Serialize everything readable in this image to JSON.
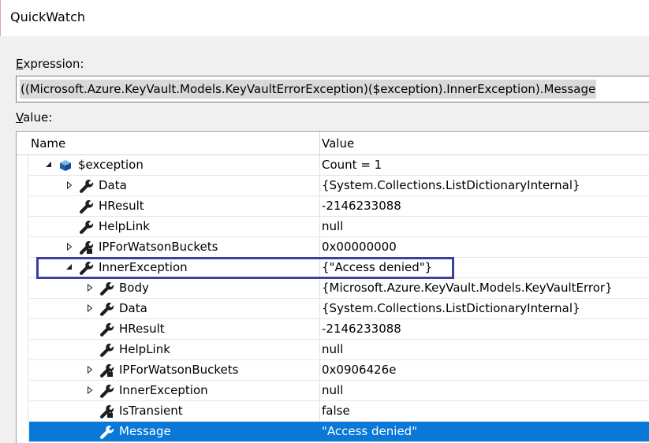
{
  "window": {
    "title": "QuickWatch"
  },
  "expression": {
    "label_underlined": "E",
    "label_rest": "xpression:",
    "value": "((Microsoft.Azure.KeyVault.Models.KeyVaultErrorException)($exception).InnerException).Message"
  },
  "value_label": {
    "label_underlined": "V",
    "label_rest": "alue:"
  },
  "grid": {
    "columns": {
      "name": "Name",
      "value": "Value"
    },
    "rows": [
      {
        "name": "$exception",
        "value": "Count = 1",
        "depth": 0,
        "expander": "expanded",
        "icon": "object-cube-icon"
      },
      {
        "name": "Data",
        "value": "{System.Collections.ListDictionaryInternal}",
        "depth": 1,
        "expander": "collapsed",
        "icon": "wrench-icon"
      },
      {
        "name": "HResult",
        "value": "-2146233088",
        "depth": 1,
        "expander": "none",
        "icon": "wrench-icon"
      },
      {
        "name": "HelpLink",
        "value": "null",
        "depth": 1,
        "expander": "none",
        "icon": "wrench-icon"
      },
      {
        "name": "IPForWatsonBuckets",
        "value": "0x00000000",
        "depth": 1,
        "expander": "collapsed",
        "icon": "private-wrench-icon"
      },
      {
        "name": "InnerException",
        "value": "{\"Access denied\"}",
        "depth": 1,
        "expander": "expanded",
        "icon": "wrench-icon"
      },
      {
        "name": "Body",
        "value": "{Microsoft.Azure.KeyVault.Models.KeyVaultError}",
        "depth": 2,
        "expander": "collapsed",
        "icon": "wrench-icon"
      },
      {
        "name": "Data",
        "value": "{System.Collections.ListDictionaryInternal}",
        "depth": 2,
        "expander": "collapsed",
        "icon": "wrench-icon"
      },
      {
        "name": "HResult",
        "value": "-2146233088",
        "depth": 2,
        "expander": "none",
        "icon": "wrench-icon"
      },
      {
        "name": "HelpLink",
        "value": "null",
        "depth": 2,
        "expander": "none",
        "icon": "wrench-icon"
      },
      {
        "name": "IPForWatsonBuckets",
        "value": "0x0906426e",
        "depth": 2,
        "expander": "collapsed",
        "icon": "private-wrench-icon"
      },
      {
        "name": "InnerException",
        "value": "null",
        "depth": 2,
        "expander": "collapsed",
        "icon": "wrench-icon"
      },
      {
        "name": "IsTransient",
        "value": "false",
        "depth": 2,
        "expander": "none",
        "icon": "private-wrench-icon"
      },
      {
        "name": "Message",
        "value": "\"Access denied\"",
        "depth": 2,
        "expander": "none",
        "icon": "wrench-icon",
        "selected": true
      }
    ]
  },
  "colors": {
    "selection": "#0a78d7",
    "highlight_box": "#3b3fa3",
    "cube": "#1e5fa8"
  }
}
